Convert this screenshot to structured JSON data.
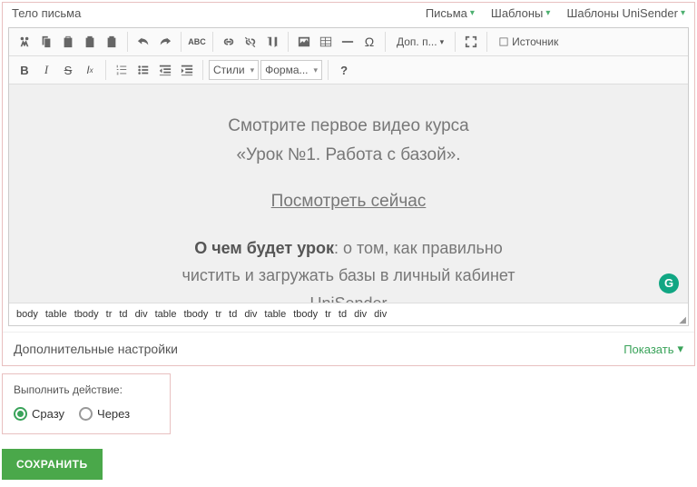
{
  "header": {
    "title": "Тело письма",
    "tabs": [
      "Письма",
      "Шаблоны",
      "Шаблоны UniSender"
    ]
  },
  "toolbar": {
    "dropdown_more": "Доп. п...",
    "source": "Источник",
    "styles": "Стили",
    "format": "Форма..."
  },
  "content": {
    "line1": "Смотрите первое видео курса",
    "line2": "«Урок №1. Работа с базой».",
    "link": "Посмотреть сейчас",
    "line3_bold": "О чем будет урок",
    "line3_rest": ": о том, как правильно",
    "line4": "чистить и загружать базы в личный кабинет",
    "line5": "UniSender",
    "badge": "G"
  },
  "path": [
    "body",
    "table",
    "tbody",
    "tr",
    "td",
    "div",
    "table",
    "tbody",
    "tr",
    "td",
    "div",
    "table",
    "tbody",
    "tr",
    "td",
    "div",
    "div"
  ],
  "settings": {
    "label": "Дополнительные настройки",
    "show": "Показать"
  },
  "action": {
    "question": "Выполнить действие:",
    "opt1": "Сразу",
    "opt2": "Через"
  },
  "save": "СОХРАНИТЬ"
}
